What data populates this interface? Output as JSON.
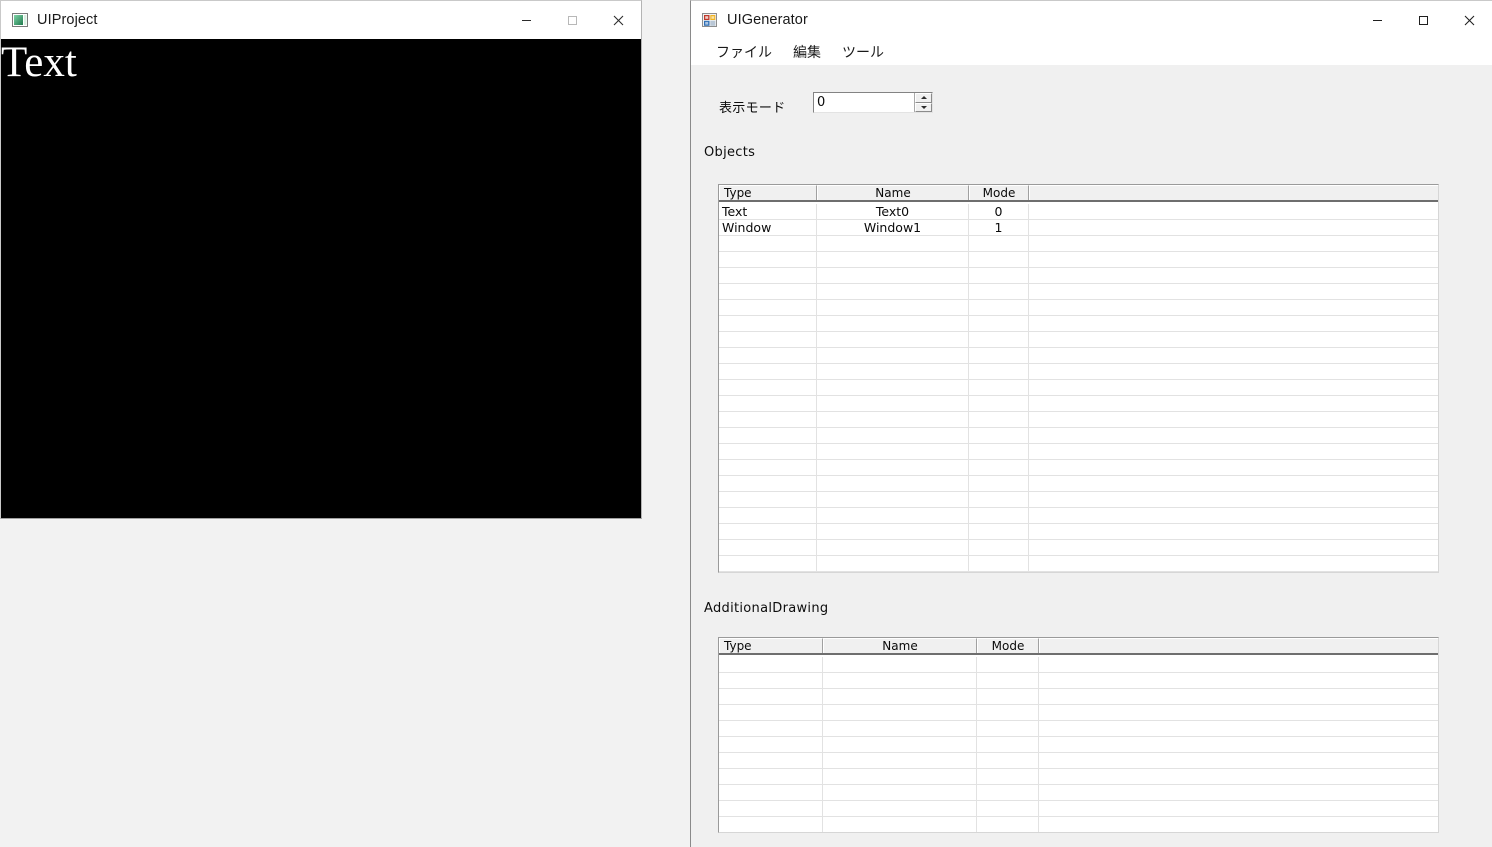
{
  "desktop": {
    "background_color": "#f2f2f2"
  },
  "project_window": {
    "title": "UIProject",
    "icon": "picture-app-icon",
    "caption_buttons": {
      "minimize": "minimize-icon",
      "maximize": "maximize-icon",
      "close": "close-icon"
    },
    "canvas": {
      "background_color": "#000000",
      "text": "Text",
      "text_color": "#ffffff"
    }
  },
  "generator_window": {
    "title": "UIGenerator",
    "icon": "winforms-app-icon",
    "caption_buttons": {
      "minimize": "minimize-icon",
      "maximize": "maximize-icon",
      "close": "close-icon"
    },
    "menubar": [
      {
        "label": "ファイル"
      },
      {
        "label": "編集"
      },
      {
        "label": "ツール"
      }
    ],
    "display_mode": {
      "label": "表示モード",
      "value": "0",
      "spin_up": "spin-up-arrow-icon",
      "spin_down": "spin-down-arrow-icon"
    },
    "objects_section": {
      "label": "Objects",
      "columns": [
        {
          "key": "type",
          "header": "Type",
          "align": "left"
        },
        {
          "key": "name",
          "header": "Name",
          "align": "center"
        },
        {
          "key": "mode",
          "header": "Mode",
          "align": "center"
        },
        {
          "key": "blank",
          "header": "",
          "align": "left"
        }
      ],
      "rows": [
        {
          "type": "Text",
          "name": "Text0",
          "mode": "0",
          "blank": ""
        },
        {
          "type": "Window",
          "name": "Window1",
          "mode": "1",
          "blank": ""
        }
      ],
      "empty_row_count": 21
    },
    "additional_drawing_section": {
      "label": "AdditionalDrawing",
      "columns": [
        {
          "key": "type",
          "header": "Type",
          "align": "left"
        },
        {
          "key": "name",
          "header": "Name",
          "align": "center"
        },
        {
          "key": "mode",
          "header": "Mode",
          "align": "center"
        },
        {
          "key": "blank",
          "header": "",
          "align": "left"
        }
      ],
      "rows": [],
      "empty_row_count": 11
    }
  }
}
